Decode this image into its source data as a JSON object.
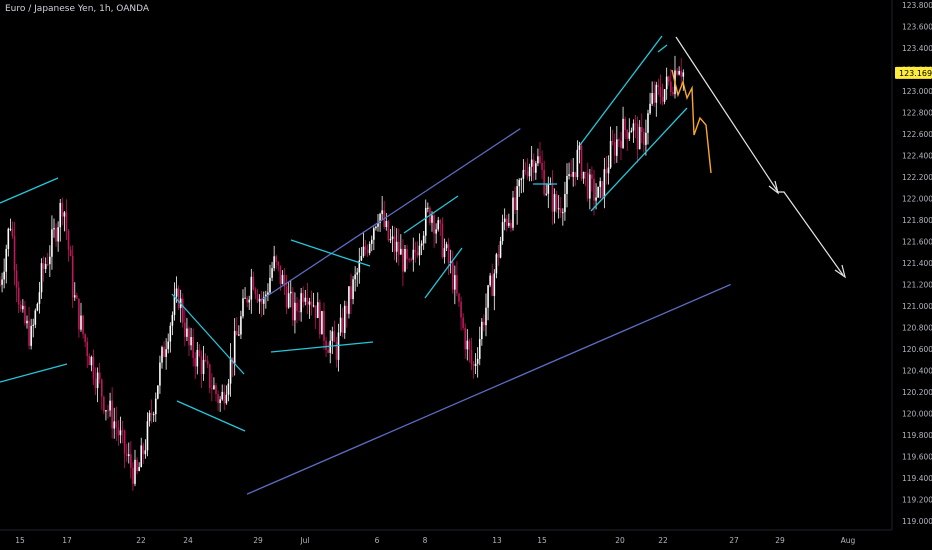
{
  "header": {
    "symbol_title": "Euro / Japanese Yen, 1h, OANDA"
  },
  "colors": {
    "background": "#000000",
    "bull_candle": "#ffffff",
    "bear_candle": "#c2185b",
    "channel_line": "#5c6bc0",
    "pattern_line": "#26c6da",
    "projection_line": "#f9a825",
    "arrow_line": "#e6e6e6",
    "price_badge": "#ffeb3b"
  },
  "chart_data": {
    "type": "candlestick",
    "symbol": "Euro / Japanese Yen",
    "interval": "1h",
    "source": "OANDA",
    "current_price": "123.169",
    "ylim": [
      119.0,
      123.8
    ],
    "y_ticks": [
      "123.800",
      "123.600",
      "123.400",
      "123.200",
      "123.000",
      "122.800",
      "122.600",
      "122.400",
      "122.200",
      "122.000",
      "121.800",
      "121.600",
      "121.400",
      "121.200",
      "121.000",
      "120.800",
      "120.600",
      "120.400",
      "120.200",
      "120.000",
      "119.800",
      "119.600",
      "119.400",
      "119.200",
      "119.000"
    ],
    "x_tick_labels": [
      "15",
      "17",
      "22",
      "24",
      "29",
      "Jul",
      "6",
      "8",
      "13",
      "15",
      "20",
      "22",
      "27",
      "29",
      "Aug"
    ],
    "price_path": [
      [
        0,
        121.2
      ],
      [
        2,
        121.8
      ],
      [
        4,
        120.9
      ],
      [
        6,
        120.7
      ],
      [
        8,
        121.3
      ],
      [
        10,
        121.6
      ],
      [
        12,
        122.0
      ],
      [
        14,
        121.1
      ],
      [
        16,
        120.7
      ],
      [
        18,
        120.4
      ],
      [
        20,
        120.1
      ],
      [
        22,
        119.9
      ],
      [
        24,
        119.6
      ],
      [
        26,
        119.4
      ],
      [
        28,
        119.8
      ],
      [
        30,
        120.3
      ],
      [
        32,
        120.8
      ],
      [
        34,
        121.1
      ],
      [
        36,
        120.6
      ],
      [
        38,
        120.5
      ],
      [
        40,
        120.3
      ],
      [
        42,
        120.1
      ],
      [
        44,
        120.5
      ],
      [
        46,
        120.9
      ],
      [
        48,
        121.3
      ],
      [
        50,
        121.0
      ],
      [
        52,
        121.4
      ],
      [
        54,
        121.2
      ],
      [
        56,
        120.9
      ],
      [
        58,
        121.2
      ],
      [
        60,
        121.0
      ],
      [
        62,
        120.7
      ],
      [
        64,
        120.6
      ],
      [
        66,
        121.0
      ],
      [
        68,
        121.3
      ],
      [
        70,
        121.6
      ],
      [
        72,
        121.9
      ],
      [
        74,
        121.6
      ],
      [
        76,
        121.5
      ],
      [
        78,
        121.3
      ],
      [
        80,
        121.7
      ],
      [
        82,
        121.9
      ],
      [
        84,
        121.6
      ],
      [
        86,
        121.3
      ],
      [
        88,
        120.8
      ],
      [
        90,
        120.4
      ],
      [
        92,
        120.9
      ],
      [
        94,
        121.3
      ],
      [
        96,
        121.8
      ],
      [
        98,
        121.9
      ],
      [
        100,
        122.3
      ],
      [
        102,
        122.4
      ],
      [
        104,
        122.1
      ],
      [
        106,
        121.9
      ],
      [
        108,
        122.1
      ],
      [
        110,
        122.4
      ],
      [
        112,
        122.1
      ],
      [
        114,
        122.0
      ],
      [
        116,
        122.4
      ],
      [
        118,
        122.6
      ],
      [
        120,
        122.7
      ],
      [
        122,
        122.5
      ],
      [
        124,
        122.9
      ],
      [
        126,
        123.0
      ],
      [
        128,
        123.1
      ],
      [
        129,
        123.3
      ],
      [
        130,
        123.169
      ]
    ],
    "annotations": {
      "channel_upper": [
        [
          49.5,
          121.05
        ],
        [
          99,
          122.65
        ]
      ],
      "channel_lower": [
        [
          47,
          119.25
        ],
        [
          139,
          121.2
        ]
      ],
      "projection": [
        [
          130,
          123.169
        ],
        [
          131,
          123.0
        ],
        [
          132,
          122.9
        ],
        [
          133,
          122.8
        ],
        [
          134,
          122.6
        ],
        [
          135,
          122.5
        ],
        [
          137,
          122.2
        ]
      ],
      "arrow_path": [
        [
          131,
          123.55
        ],
        [
          148,
          122.1
        ],
        [
          149,
          122.1
        ],
        [
          160,
          121.3
        ]
      ]
    }
  }
}
